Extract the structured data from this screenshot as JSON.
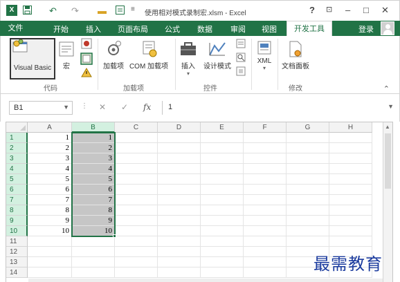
{
  "window": {
    "title": "使用相对模式录制宏.xlsm - Excel",
    "app_icon_label": "X"
  },
  "title_controls": {
    "help": "?",
    "restore_ribbon": "⊡",
    "minimize": "–",
    "maximize": "□",
    "close": "✕"
  },
  "qat": {
    "undo": "↶",
    "redo": "↷"
  },
  "tabs": [
    {
      "label": "文件"
    },
    {
      "label": "开始"
    },
    {
      "label": "插入"
    },
    {
      "label": "页面布局"
    },
    {
      "label": "公式"
    },
    {
      "label": "数据"
    },
    {
      "label": "审阅"
    },
    {
      "label": "视图"
    },
    {
      "label": "开发工具"
    }
  ],
  "account": {
    "login": "登录"
  },
  "ribbon": {
    "groups": [
      {
        "label": "代码"
      },
      {
        "label": "加载项"
      },
      {
        "label": "控件"
      },
      {
        "label": "修改"
      }
    ],
    "buttons": {
      "visual_basic": "Visual Basic",
      "macros": "宏",
      "addins": "加载项",
      "com_addins": "COM 加载项",
      "insert": "插入",
      "design_mode": "设计模式",
      "xml": "XML",
      "doc_panel": "文档面板"
    }
  },
  "formula_bar": {
    "name_box": "B1",
    "cancel": "✕",
    "enter": "✓",
    "fx": "fx",
    "value": "1"
  },
  "sheet": {
    "columns": [
      "A",
      "B",
      "C",
      "D",
      "E",
      "F",
      "G",
      "H"
    ],
    "rows": [
      "1",
      "2",
      "3",
      "4",
      "5",
      "6",
      "7",
      "8",
      "9",
      "10",
      "11",
      "12",
      "13",
      "14"
    ],
    "col_a": [
      "1",
      "2",
      "3",
      "4",
      "5",
      "6",
      "7",
      "8",
      "9",
      "10"
    ],
    "col_b": [
      "1",
      "2",
      "3",
      "4",
      "5",
      "6",
      "7",
      "8",
      "9",
      "10"
    ],
    "selected_range": "B1:B10"
  },
  "watermark": "最需教育",
  "colors": {
    "accent": "#217346",
    "selection_fill": "#c6c6c6",
    "watermark": "#1b3b9e"
  }
}
